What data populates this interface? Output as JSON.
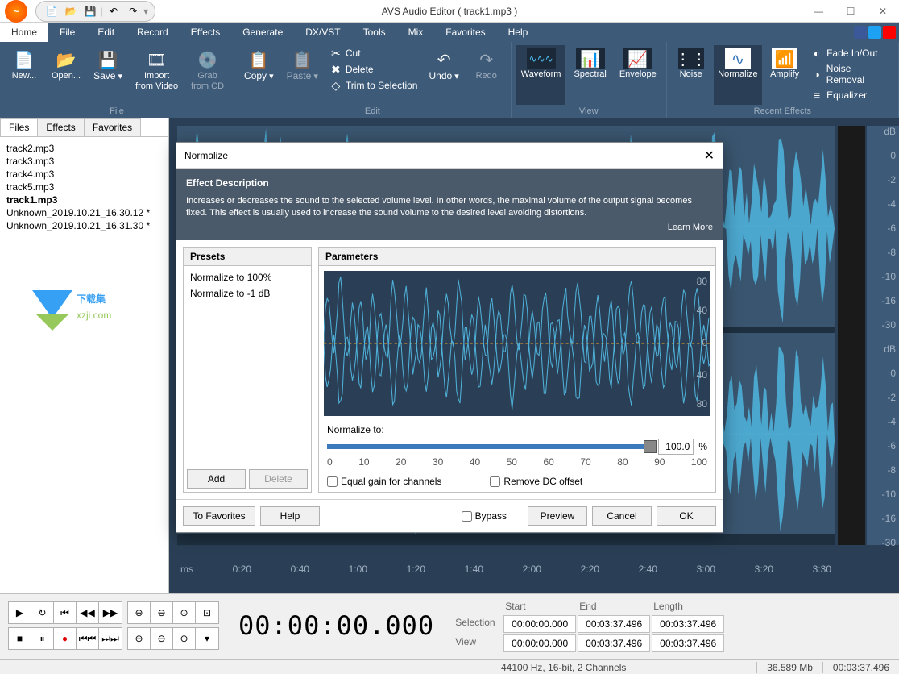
{
  "title": "AVS Audio Editor  ( track1.mp3 )",
  "qat": {
    "new": "📄",
    "open": "📂",
    "save": "💾",
    "undo": "↶",
    "redo": "↷"
  },
  "menu": [
    "Home",
    "File",
    "Edit",
    "Record",
    "Effects",
    "Generate",
    "DX/VST",
    "Tools",
    "Mix",
    "Favorites",
    "Help"
  ],
  "menu_active": "Home",
  "ribbon": {
    "file": {
      "caption": "File",
      "new": "New...",
      "open": "Open...",
      "save": "Save",
      "import": "Import\nfrom Video",
      "grab": "Grab\nfrom CD"
    },
    "edit": {
      "caption": "Edit",
      "copy": "Copy",
      "paste": "Paste",
      "cut": "Cut",
      "delete": "Delete",
      "trim": "Trim to Selection",
      "undo": "Undo",
      "redo": "Redo"
    },
    "view": {
      "caption": "View",
      "waveform": "Waveform",
      "spectral": "Spectral",
      "envelope": "Envelope"
    },
    "recent": {
      "caption": "Recent Effects",
      "noise": "Noise",
      "normalize": "Normalize",
      "amplify": "Amplify",
      "fade": "Fade In/Out",
      "nr": "Noise Removal",
      "eq": "Equalizer"
    }
  },
  "side_tabs": [
    "Files",
    "Effects",
    "Favorites"
  ],
  "side_active": "Files",
  "files": [
    "track2.mp3",
    "track3.mp3",
    "track4.mp3",
    "track5.mp3",
    "track1.mp3",
    "Unknown_2019.10.21_16.30.12 *",
    "Unknown_2019.10.21_16.31.30 *"
  ],
  "file_active": "track1.mp3",
  "ruler_right": [
    "dB",
    "0",
    "-2",
    "-4",
    "-6",
    "-8",
    "-10",
    "-16",
    "-30",
    "dB",
    "0",
    "-2",
    "-4",
    "-6",
    "-8",
    "-10",
    "-16",
    "-30"
  ],
  "time_marks": [
    "ms",
    "0:20",
    "0:40",
    "1:00",
    "1:20",
    "1:40",
    "2:00",
    "2:20",
    "2:40",
    "3:00",
    "3:20",
    "3:30"
  ],
  "dialog": {
    "title": "Normalize",
    "desc_heading": "Effect Description",
    "desc_text": "Increases or decreases the sound to the selected volume level. In other words, the maximal volume of the output signal becomes fixed. This effect is usually used to increase the sound volume to the desired level avoiding distortions.",
    "learn_more": "Learn More",
    "presets_heading": "Presets",
    "presets": [
      "Normalize to 100%",
      "Normalize to -1 dB"
    ],
    "params_heading": "Parameters",
    "wv_scale": [
      "80",
      "40",
      "0",
      "40",
      "80"
    ],
    "normalize_label": "Normalize to:",
    "normalize_value": "100.0",
    "normalize_unit": "%",
    "ticks": [
      "0",
      "10",
      "20",
      "30",
      "40",
      "50",
      "60",
      "70",
      "80",
      "90",
      "100"
    ],
    "check1": "Equal gain for channels",
    "check2": "Remove DC offset",
    "btn_add": "Add",
    "btn_delete": "Delete",
    "btn_fav": "To Favorites",
    "btn_help": "Help",
    "btn_bypass": "Bypass",
    "btn_preview": "Preview",
    "btn_cancel": "Cancel",
    "btn_ok": "OK"
  },
  "transport": {
    "time": "00:00:00.000",
    "headers": [
      "",
      "Start",
      "End",
      "Length"
    ],
    "selection": [
      "Selection",
      "00:00:00.000",
      "00:03:37.496",
      "00:03:37.496"
    ],
    "view": [
      "View",
      "00:00:00.000",
      "00:03:37.496",
      "00:03:37.496"
    ]
  },
  "status": {
    "format": "44100 Hz, 16-bit, 2 Channels",
    "size": "36.589 Mb",
    "dur": "00:03:37.496"
  },
  "watermark": {
    "text1": "下载集",
    "text2": "xzji.com"
  }
}
